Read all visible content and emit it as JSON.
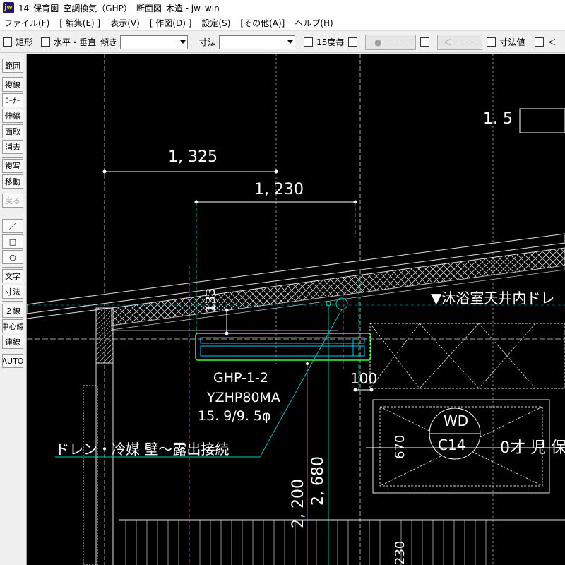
{
  "window": {
    "title": "14_保育園_空調換気（GHP）_断面図_木造 - jw_win",
    "icon_label": "jw"
  },
  "menu": [
    "ファイル(F)",
    "[ 編集(E) ]",
    "表示(V)",
    "[ 作図(D) ]",
    "設定(S)",
    "[その他(A)]",
    "ヘルプ(H)"
  ],
  "toolbar": {
    "rect_label": "矩形",
    "hv_label": "水平・垂直",
    "tilt_label": "傾き",
    "tilt_value": "",
    "dim_label": "寸法",
    "dim_value": "",
    "deg15_label": "15度毎",
    "btn_circle_label": "●－－－",
    "btn_arrow_label": "＜－－－",
    "dimval_label": "寸法値",
    "last_label": "＜"
  },
  "sidebar": {
    "items": [
      "範囲",
      "複線",
      "ｺｰﾅｰ",
      "伸縮",
      "面取",
      "消去",
      "複写",
      "移動",
      "戻る",
      "／",
      "□",
      "○",
      "文字",
      "寸法",
      "２線",
      "中心線",
      "連線",
      "AUTO"
    ]
  },
  "drawing": {
    "dim_1325": "1, 325",
    "dim_1230": "1, 230",
    "dim_1_5": "1. 5",
    "dim_133": "133",
    "dim_100": "100",
    "dim_2200": "2, 200",
    "dim_2680": "2, 680",
    "dim_670": "670",
    "dim_230": "230",
    "unit_name": "GHP-1-2",
    "unit_model": "YZHP80MA",
    "pipe_size": "15. 9/9. 5φ",
    "note_drain": "ドレン・冷媒 壁～露出接続",
    "note_bath": "▼沐浴室天井内ドレ",
    "wd_tag": "WD",
    "wd_code": "C14",
    "room_label": "0才 児 保"
  },
  "colors": {
    "canvas_bg": "#000000",
    "dim_line": "#ffffff",
    "aux_line": "#00c8c8",
    "unit_outline": "#33ff33",
    "text_white": "#ffffff"
  }
}
